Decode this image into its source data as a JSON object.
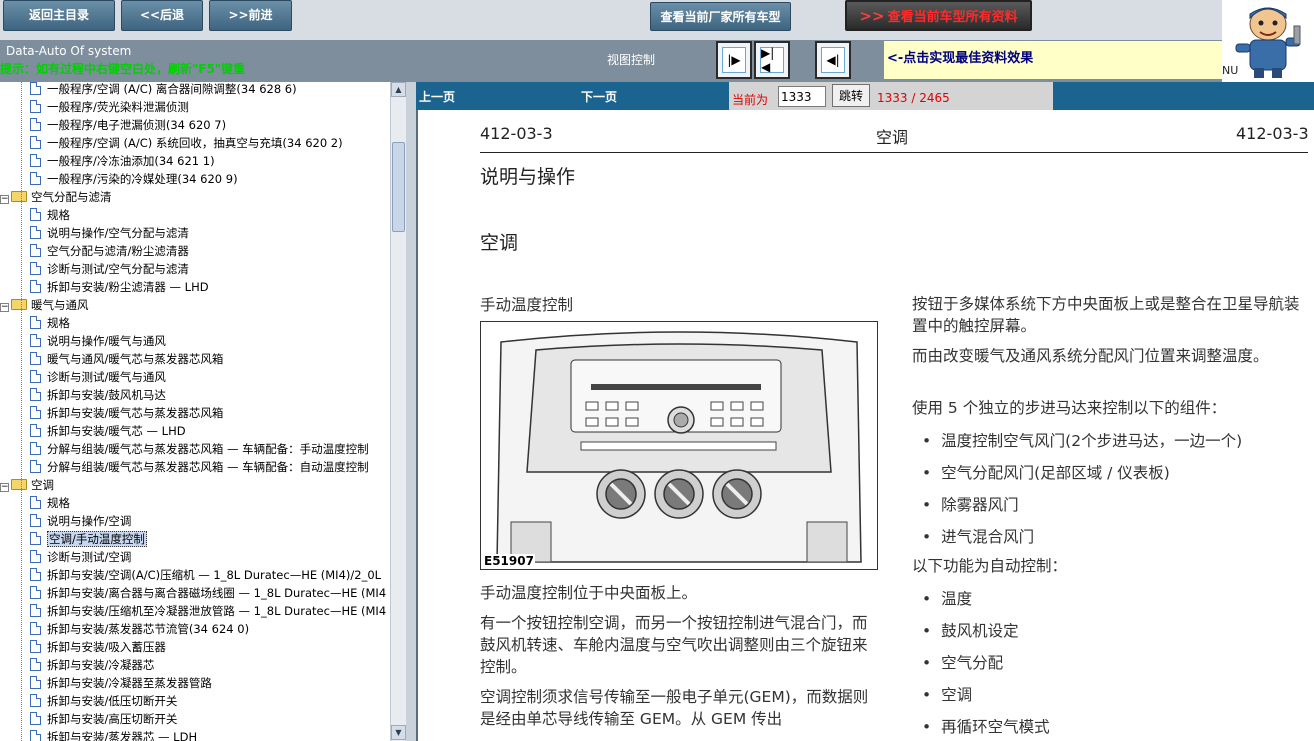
{
  "toolbar": {
    "home": "返回主目录",
    "back": "<<后退",
    "forward": ">>前进",
    "maker_models": "查看当前厂家所有车型",
    "model_docs_arrow": ">>",
    "model_docs": "查看当前车型所有资料"
  },
  "system_bar": {
    "title": "Data-Auto Of system",
    "hint": "提示：如有过程中右键空白处，刷新\"F5\"键重",
    "view_control": "视图控制",
    "best_view_hint": "<-点击实现最佳资料效果",
    "nu": "NU"
  },
  "tree": {
    "items": [
      {
        "type": "doc",
        "label": "一般程序/空调 (A/C) 离合器间隙调整(34 628 6)"
      },
      {
        "type": "doc",
        "label": "一般程序/荧光染料泄漏侦测"
      },
      {
        "type": "doc",
        "label": "一般程序/电子泄漏侦测(34 620 7)"
      },
      {
        "type": "doc",
        "label": "一般程序/空调 (A/C) 系统回收，抽真空与充填(34 620 2)"
      },
      {
        "type": "doc",
        "label": "一般程序/冷冻油添加(34 621 1)"
      },
      {
        "type": "doc",
        "label": "一般程序/污染的冷媒处理(34 620 9)"
      },
      {
        "type": "folder",
        "label": "空气分配与滤清"
      },
      {
        "type": "doc",
        "label": "规格"
      },
      {
        "type": "doc",
        "label": "说明与操作/空气分配与滤清"
      },
      {
        "type": "doc",
        "label": "空气分配与滤清/粉尘滤清器"
      },
      {
        "type": "doc",
        "label": "诊断与测试/空气分配与滤清"
      },
      {
        "type": "doc",
        "label": "拆卸与安装/粉尘滤清器 — LHD"
      },
      {
        "type": "folder",
        "label": "暖气与通风"
      },
      {
        "type": "doc",
        "label": "规格"
      },
      {
        "type": "doc",
        "label": "说明与操作/暖气与通风"
      },
      {
        "type": "doc",
        "label": "暖气与通风/暖气芯与蒸发器芯风箱"
      },
      {
        "type": "doc",
        "label": "诊断与测试/暖气与通风"
      },
      {
        "type": "doc",
        "label": "拆卸与安装/鼓风机马达"
      },
      {
        "type": "doc",
        "label": "拆卸与安装/暖气芯与蒸发器芯风箱"
      },
      {
        "type": "doc",
        "label": "拆卸与安装/暖气芯 — LHD"
      },
      {
        "type": "doc",
        "label": "分解与组装/暖气芯与蒸发器芯风箱 — 车辆配备：手动温度控制"
      },
      {
        "type": "doc",
        "label": "分解与组装/暖气芯与蒸发器芯风箱 — 车辆配备：自动温度控制"
      },
      {
        "type": "folder",
        "label": "空调"
      },
      {
        "type": "doc",
        "label": "规格"
      },
      {
        "type": "doc",
        "label": "说明与操作/空调"
      },
      {
        "type": "doc",
        "label": "空调/手动温度控制",
        "selected": true
      },
      {
        "type": "doc",
        "label": "诊断与测试/空调"
      },
      {
        "type": "doc",
        "label": "拆卸与安装/空调(A/C)压缩机 — 1_8L Duratec—HE (MI4)/2_0L"
      },
      {
        "type": "doc",
        "label": "拆卸与安装/离合器与离合器磁场线圈 — 1_8L Duratec—HE (MI4"
      },
      {
        "type": "doc",
        "label": "拆卸与安装/压缩机至冷凝器泄放管路 — 1_8L Duratec—HE (MI4"
      },
      {
        "type": "doc",
        "label": "拆卸与安装/蒸发器芯节流管(34 624 0)"
      },
      {
        "type": "doc",
        "label": "拆卸与安装/吸入蓄压器"
      },
      {
        "type": "doc",
        "label": "拆卸与安装/冷凝器芯"
      },
      {
        "type": "doc",
        "label": "拆卸与安装/冷凝器至蒸发器管路"
      },
      {
        "type": "doc",
        "label": "拆卸与安装/低压切断开关"
      },
      {
        "type": "doc",
        "label": "拆卸与安装/高压切断开关"
      },
      {
        "type": "doc",
        "label": "拆卸与安装/蒸发器芯 — LDH"
      }
    ]
  },
  "pagebar": {
    "prev": "上一页",
    "next": "下一页",
    "current_label": "当前为",
    "current_value": "1333",
    "jump": "跳转",
    "count": "1333 / 2465"
  },
  "doc": {
    "header_left": "412-03-3",
    "header_mid": "空调",
    "header_right": "412-03-3",
    "section_title": "说明与操作",
    "subtitle": "空调",
    "fig_title": "手动温度控制",
    "fig_label": "E51907",
    "p1": "手动温度控制位于中央面板上。",
    "p2": "有一个按钮控制空调，而另一个按钮控制进气混合门，而鼓风机转速、车舱内温度与空气吹出调整则由三个旋钮来控制。",
    "p3": "空调控制须求信号传输至一般电子单元(GEM)，而数据则是经由单芯导线传输至 GEM。从 GEM 传出",
    "r1": "按钮于多媒体系统下方中央面板上或是整合在卫星导航装置中的触控屏幕。",
    "r2": "而由改变暖气及通风系统分配风门位置来调整温度。",
    "r3": "使用 5 个独立的步进马达来控制以下的组件：",
    "bullets1": [
      "温度控制空气风门(2个步进马达，一边一个)",
      "空气分配风门(足部区域 / 仪表板)",
      "除雾器风门",
      "进气混合风门"
    ],
    "r4": "以下功能为自动控制：",
    "bullets2": [
      "温度",
      "鼓风机设定",
      "空气分配",
      "空调",
      "再循环空气模式"
    ]
  }
}
